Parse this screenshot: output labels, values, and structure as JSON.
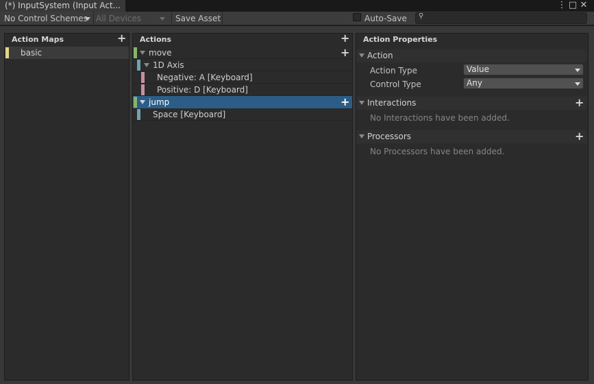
{
  "window": {
    "tab_title": "(*) InputSystem (Input Act...",
    "menu_glyph": "⋮",
    "maximize_glyph": "□",
    "close_glyph": "✕"
  },
  "toolbar": {
    "control_schemes": "No Control Schemes",
    "devices": "All Devices",
    "save_asset": "Save Asset",
    "auto_save": "Auto-Save",
    "search_glyph": "⚲"
  },
  "action_maps": {
    "header": "Action Maps",
    "items": [
      {
        "label": "basic",
        "color": "#e4d58a"
      }
    ]
  },
  "actions": {
    "header": "Actions",
    "items": [
      {
        "label": "move",
        "kind": "action"
      },
      {
        "label": "1D Axis",
        "kind": "composite"
      },
      {
        "label": "Negative: A [Keyboard]",
        "kind": "part"
      },
      {
        "label": "Positive: D [Keyboard]",
        "kind": "part"
      },
      {
        "label": "jump",
        "kind": "action",
        "selected": true
      },
      {
        "label": "Space [Keyboard]",
        "kind": "binding"
      }
    ],
    "colors": {
      "action": "#86b56c",
      "binding": "#6fa3b3",
      "part": "#c78ea5",
      "selected": "#2c5d87"
    }
  },
  "properties": {
    "header": "Action Properties",
    "action_section": "Action",
    "action_type_label": "Action Type",
    "action_type_value": "Value",
    "control_type_label": "Control Type",
    "control_type_value": "Any",
    "interactions_section": "Interactions",
    "interactions_empty": "No Interactions have been added.",
    "processors_section": "Processors",
    "processors_empty": "No Processors have been added."
  }
}
